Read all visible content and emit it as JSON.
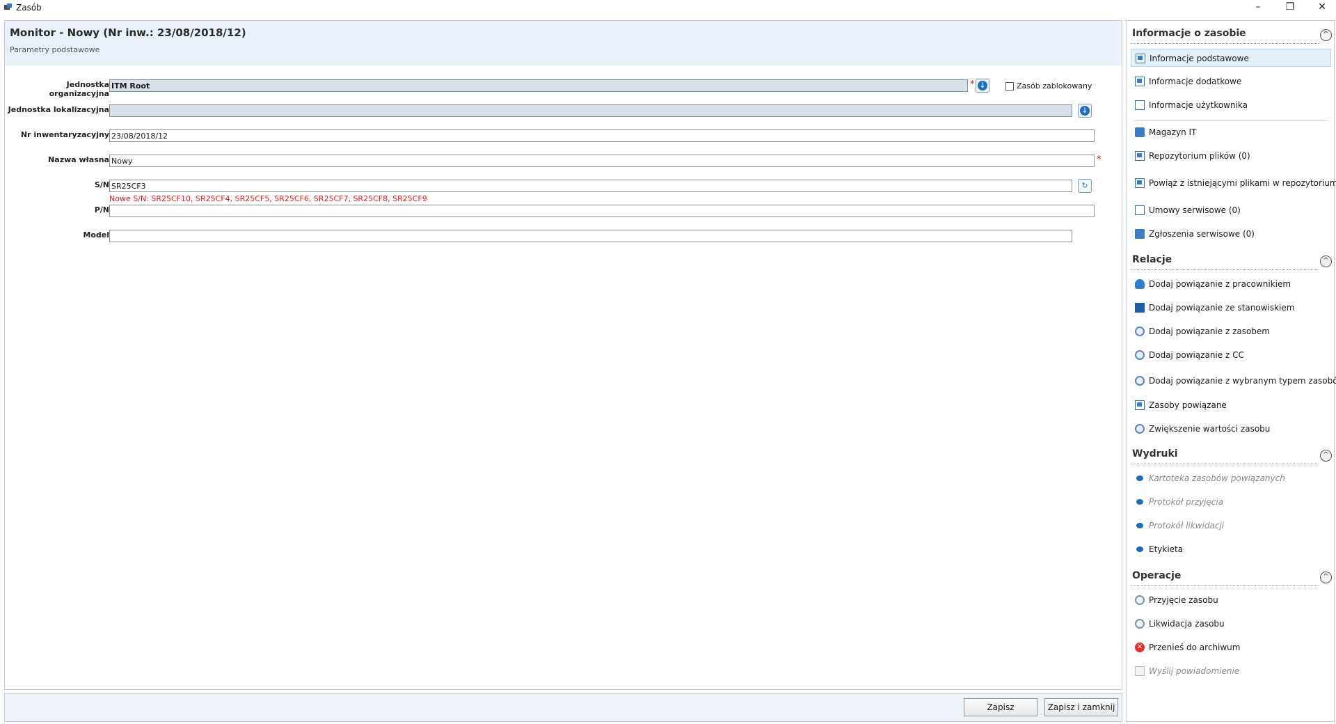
{
  "window": {
    "title": "Zasób",
    "minimize": "–",
    "restore": "❐",
    "close": "✕"
  },
  "header": {
    "title": "Monitor - Nowy (Nr inw.: 23/08/2018/12)",
    "subtitle": "Parametry podstawowe"
  },
  "form": {
    "org_unit": {
      "label": "Jednostka organizacyjna",
      "value": "ITM Root"
    },
    "blocked": {
      "label": "Zasób zablokowany",
      "checked": false
    },
    "loc_unit": {
      "label": "Jednostka lokalizacyjna",
      "value": ""
    },
    "inv_no": {
      "label": "Nr inwentaryzacyjny",
      "value": "23/08/2018/12"
    },
    "name": {
      "label": "Nazwa własna",
      "value": "Nowy"
    },
    "sn": {
      "label": "S/N",
      "value": "SR25CF3",
      "hint": "Nowe S/N: SR25CF10, SR25CF4, SR25CF5, SR25CF6, SR25CF7, SR25CF8, SR25CF9"
    },
    "pn": {
      "label": "P/N",
      "value": ""
    },
    "model": {
      "label": "Model",
      "value": ""
    },
    "required_mark": "*"
  },
  "footer": {
    "save": "Zapisz",
    "save_close": "Zapisz i zamknij"
  },
  "sidebar": {
    "collapse_glyph": "^",
    "sections": [
      {
        "title": "Informacje o zasobie",
        "items": [
          "Informacje podstawowe",
          "Informacje dodatkowe",
          "Informacje użytkownika",
          "Magazyn IT",
          "Repozytorium plików (0)",
          "Powiąż z istniejącymi plikami w repozytorium",
          "Umowy serwisowe (0)",
          "Zgłoszenia serwisowe (0)"
        ]
      },
      {
        "title": "Relacje",
        "items": [
          "Dodaj powiązanie z pracownikiem",
          "Dodaj powiązanie ze stanowiskiem",
          "Dodaj powiązanie z zasobem",
          "Dodaj powiązanie z CC",
          "Dodaj powiązanie z wybranym typem zasobów",
          "Zasoby powiązane",
          "Zwiększenie wartości zasobu"
        ]
      },
      {
        "title": "Wydruki",
        "items": [
          "Kartoteka zasobów powiązanych",
          "Protokół przyjęcia",
          "Protokół likwidacji",
          "Etykieta"
        ]
      },
      {
        "title": "Operacje",
        "items": [
          "Przyjęcie zasobu",
          "Likwidacja zasobu",
          "Przenieś do archiwum",
          "Wyślij powiadomienie"
        ]
      }
    ],
    "close_glyph": "✕"
  }
}
